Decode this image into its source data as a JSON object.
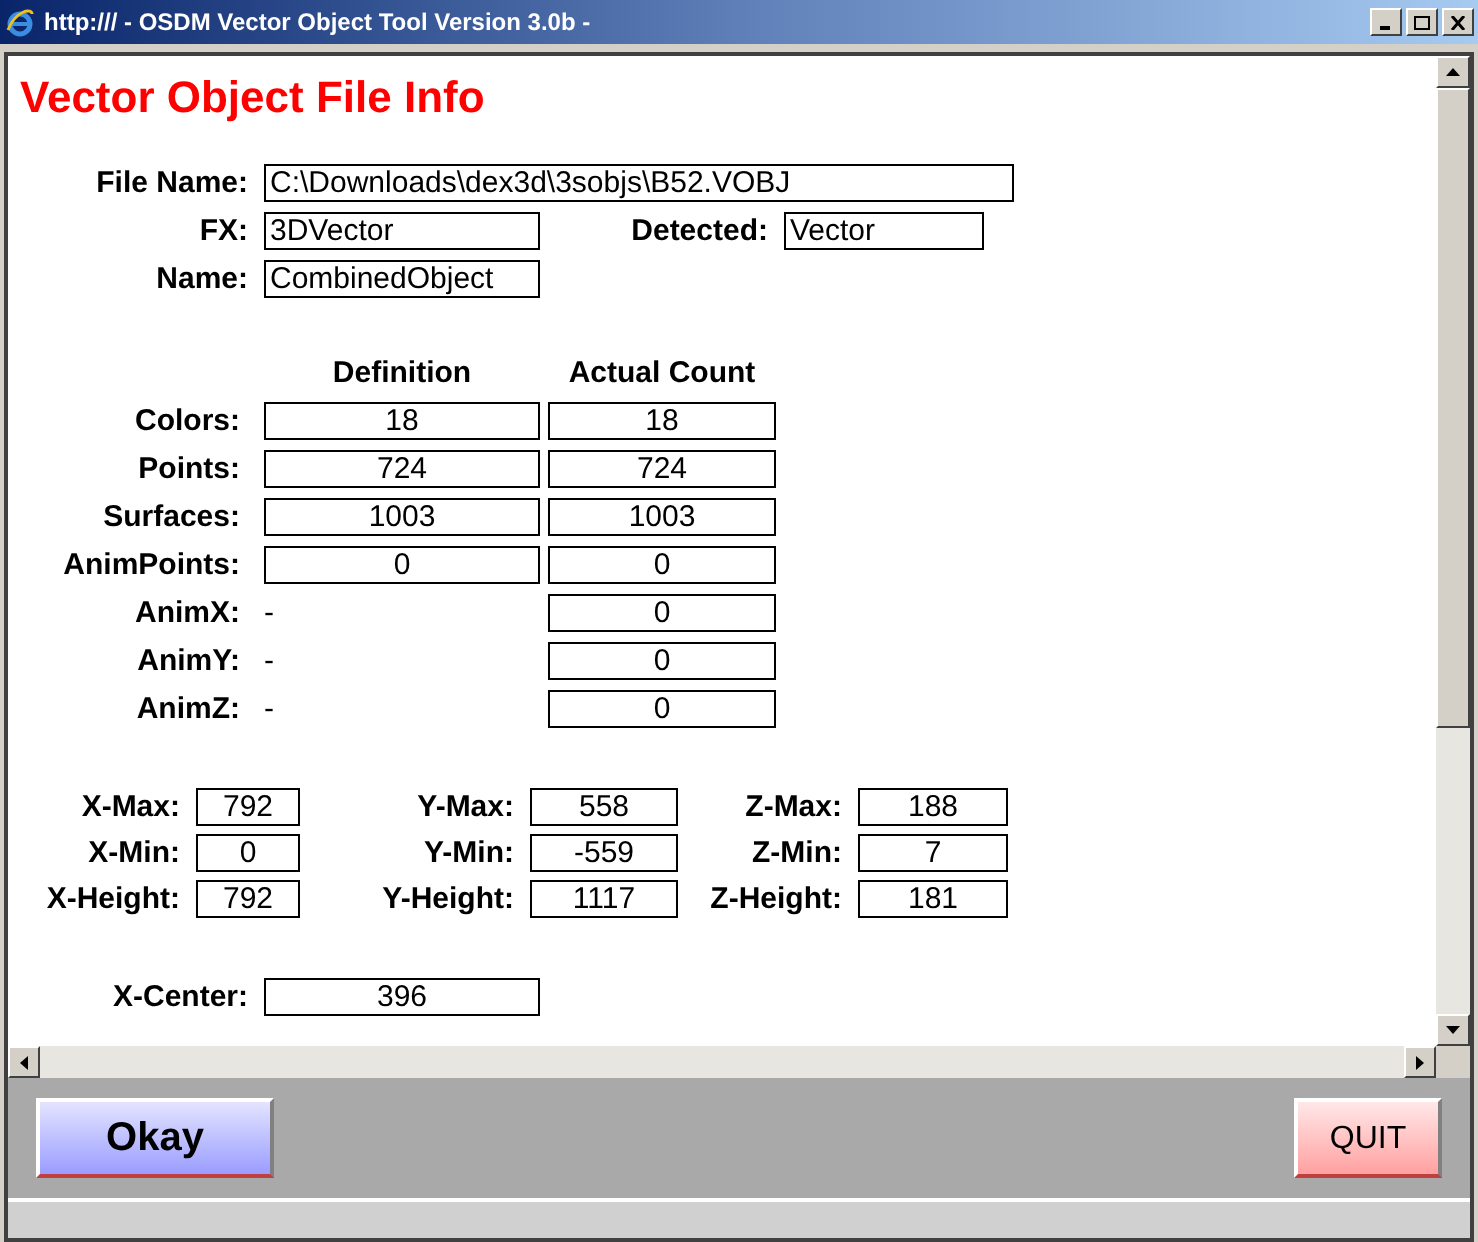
{
  "window": {
    "title": "http:/// - OSDM Vector Object Tool Version 3.0b -"
  },
  "heading": "Vector Object File Info",
  "file_info": {
    "file_name": {
      "label": "File Name:",
      "value": "C:\\Downloads\\dex3d\\3sobjs\\B52.VOBJ"
    },
    "fx": {
      "label": "FX:",
      "value": "3DVector"
    },
    "detected": {
      "label": "Detected:",
      "value": "Vector"
    },
    "name": {
      "label": "Name:",
      "value": "CombinedObject"
    }
  },
  "counts": {
    "columns": [
      "Definition",
      "Actual Count"
    ],
    "rows": [
      {
        "label": "Colors:",
        "kind": "boxed",
        "definition": "18",
        "actual": "18"
      },
      {
        "label": "Points:",
        "kind": "boxed",
        "definition": "724",
        "actual": "724"
      },
      {
        "label": "Surfaces:",
        "kind": "boxed",
        "definition": "1003",
        "actual": "1003"
      },
      {
        "label": "AnimPoints:",
        "kind": "boxed",
        "definition": "0",
        "actual": "0"
      },
      {
        "label": "AnimX:",
        "kind": "dash",
        "definition": "-",
        "actual": "0"
      },
      {
        "label": "AnimY:",
        "kind": "dash",
        "definition": "-",
        "actual": "0"
      },
      {
        "label": "AnimZ:",
        "kind": "dash",
        "definition": "-",
        "actual": "0"
      }
    ]
  },
  "extents": [
    [
      {
        "label": "X-Max:",
        "value": "792"
      },
      {
        "label": "Y-Max:",
        "value": "558"
      },
      {
        "label": "Z-Max:",
        "value": "188"
      }
    ],
    [
      {
        "label": "X-Min:",
        "value": "0"
      },
      {
        "label": "Y-Min:",
        "value": "-559"
      },
      {
        "label": "Z-Min:",
        "value": "7"
      }
    ],
    [
      {
        "label": "X-Height:",
        "value": "792"
      },
      {
        "label": "Y-Height:",
        "value": "1117"
      },
      {
        "label": "Z-Height:",
        "value": "181"
      }
    ]
  ],
  "center": [
    {
      "label": "X-Center:",
      "value": "396"
    }
  ],
  "buttons": {
    "okay": "Okay",
    "quit": "QUIT"
  }
}
